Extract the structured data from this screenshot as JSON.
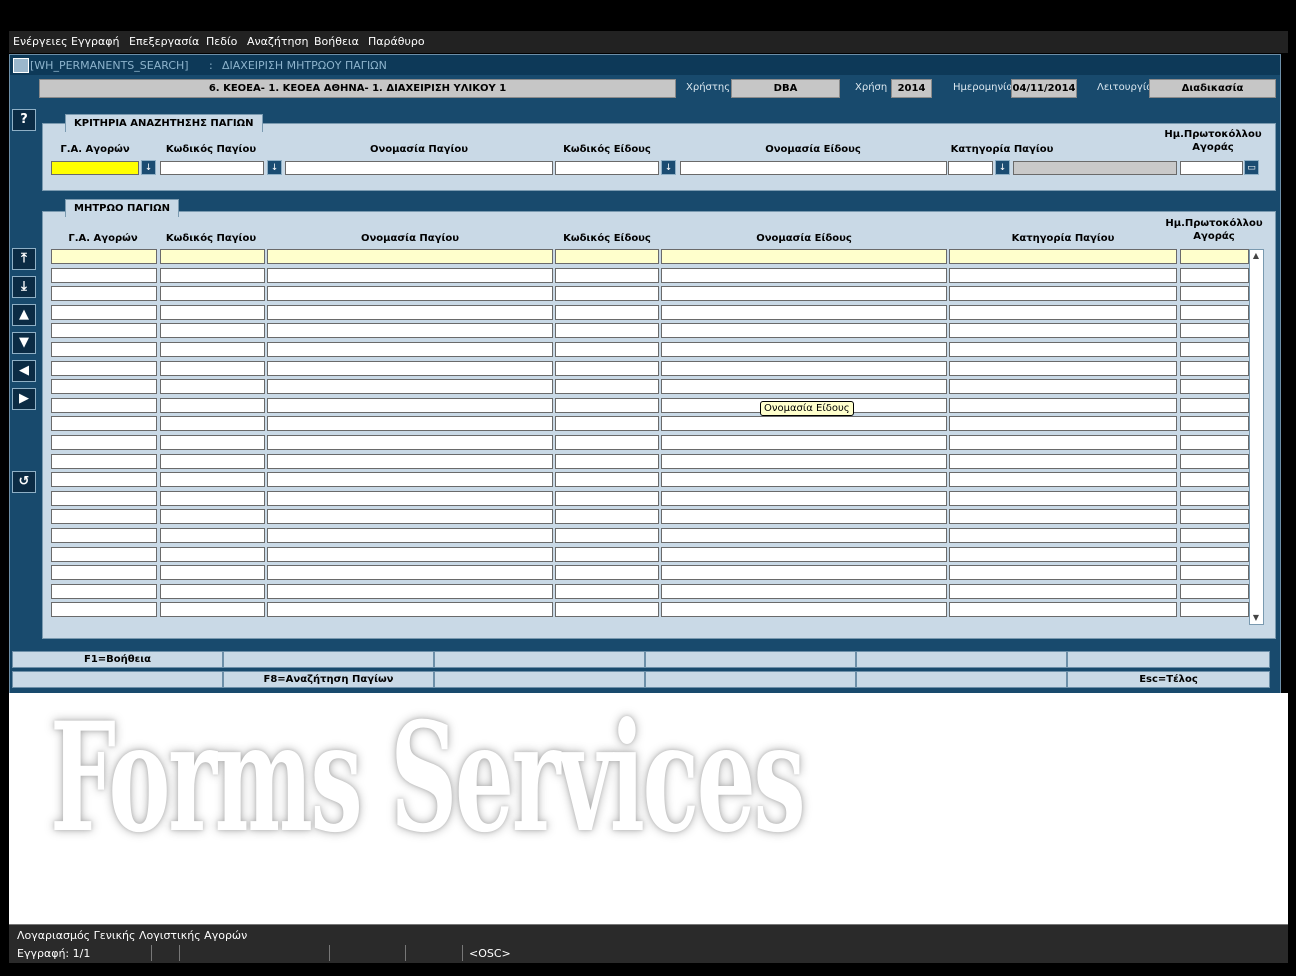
{
  "menu": [
    "Ενέργειες",
    "Εγγραφή",
    "Επεξεργασία",
    "Πεδίο",
    "Αναζήτηση",
    "Βοήθεια",
    "Παράθυρο"
  ],
  "window": {
    "title_code": "[WH_PERMANENTS_SEARCH]",
    "title_sep": ":",
    "title_name": "ΔΙΑΧΕΙΡΙΣΗ ΜΗΤΡΩΟΥ ΠΑΓΙΩΝ"
  },
  "context": {
    "org": "6. ΚΕΟΕΑ- 1. ΚΕΟΕΑ ΑΘΗΝΑ- 1. ΔΙΑΧΕΙΡΙΣΗ ΥΛΙΚΟΥ 1",
    "user_label": "Χρήστης",
    "user": "DBA",
    "year_label": "Χρήση",
    "year": "2014",
    "date_label": "Ημερομηνία",
    "date": "04/11/2014",
    "mode_label": "Λειτουργία",
    "mode": "Διαδικασία"
  },
  "search_panel": {
    "title": "ΚΡΙΤΗΡΙΑ ΑΝΑΖΗΤΗΣΗΣ ΠΑΓΙΩΝ",
    "columns": [
      "Γ.Α. Αγορών",
      "Κωδικός Παγίου",
      "Ονομασία Παγίου",
      "Κωδικός Είδους",
      "Ονομασία Είδους",
      "Κατηγορία Παγίου",
      "Ημ.Πρωτοκόλλου Αγοράς"
    ]
  },
  "register_panel": {
    "title": "ΜΗΤΡΩΟ ΠΑΓΙΩΝ",
    "columns": [
      "Γ.Α. Αγορών",
      "Κωδικός Παγίου",
      "Ονομασία Παγίου",
      "Κωδικός Είδους",
      "Ονομασία Είδους",
      "Κατηγορία Παγίου",
      "Ημ.Πρωτοκόλλου Αγοράς"
    ],
    "row_count": 20
  },
  "tooltip": "Ονομασία Είδους",
  "side_buttons": {
    "help": "?",
    "first": "⤒",
    "last": "⤓",
    "prev": "▲",
    "next": "▼",
    "left": "◀",
    "right": "▶",
    "back": "↺"
  },
  "fkeys_row1": [
    "F1=Βοήθεια",
    "",
    "",
    "",
    "",
    ""
  ],
  "fkeys_row2": [
    "",
    "F8=Αναζήτηση Παγίων",
    "",
    "",
    "",
    "Esc=Τέλος"
  ],
  "watermark": "Forms Services",
  "status": {
    "hint": "Λογαριασμός Γενικής Λογιστικής Αγορών",
    "record": "Εγγραφή: 1/1",
    "mode": "<OSC>"
  }
}
